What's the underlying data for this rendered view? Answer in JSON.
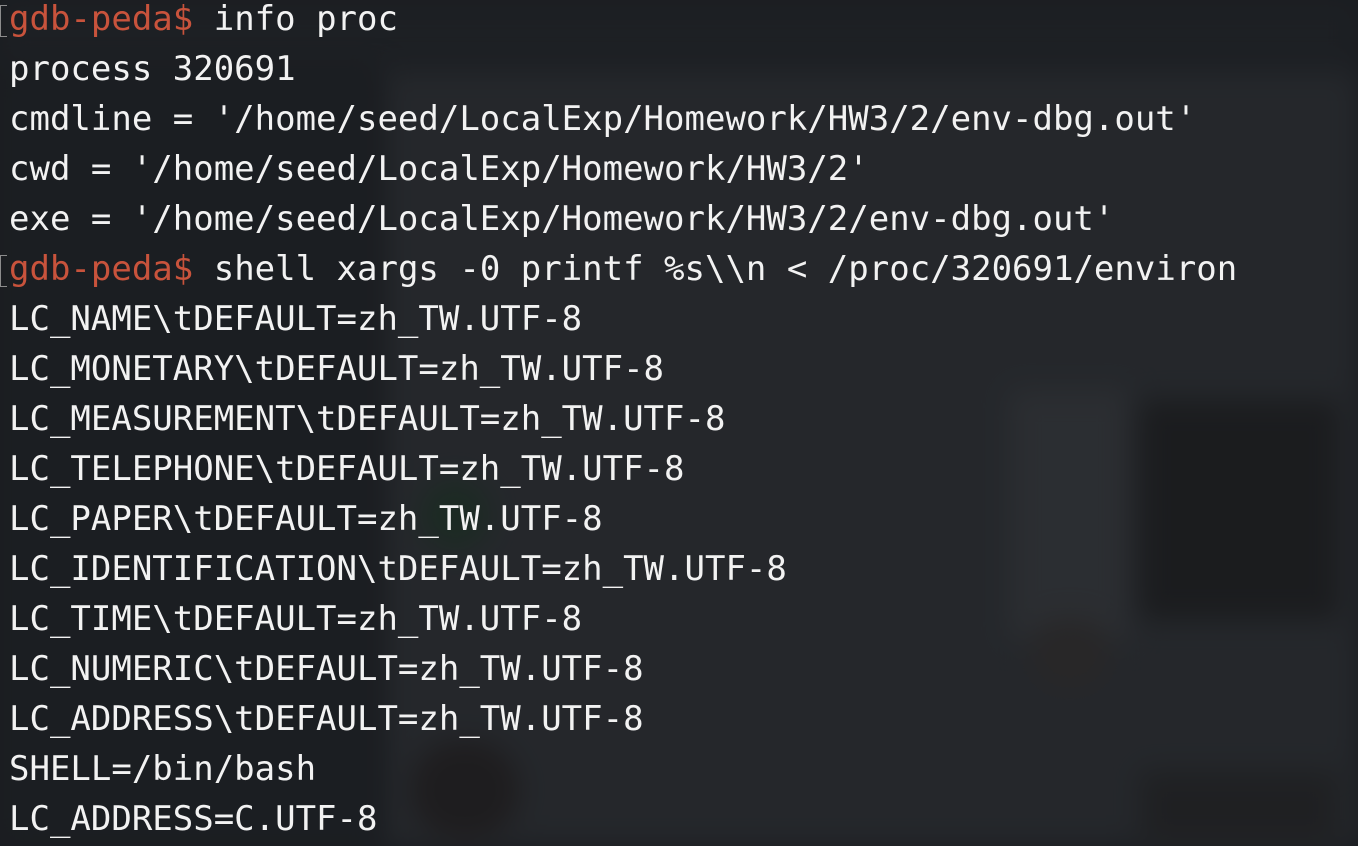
{
  "terminal": {
    "prompt": "gdb-peda$",
    "lines": [
      {
        "type": "prompt",
        "command": "info proc"
      },
      {
        "type": "output",
        "text": "process 320691"
      },
      {
        "type": "output",
        "text": "cmdline = '/home/seed/LocalExp/Homework/HW3/2/env-dbg.out'"
      },
      {
        "type": "output",
        "text": "cwd = '/home/seed/LocalExp/Homework/HW3/2'"
      },
      {
        "type": "output",
        "text": "exe = '/home/seed/LocalExp/Homework/HW3/2/env-dbg.out'"
      },
      {
        "type": "prompt",
        "command": "shell xargs -0 printf %s\\\\n < /proc/320691/environ"
      },
      {
        "type": "output",
        "text": "LC_NAME\\tDEFAULT=zh_TW.UTF-8"
      },
      {
        "type": "output",
        "text": "LC_MONETARY\\tDEFAULT=zh_TW.UTF-8"
      },
      {
        "type": "output",
        "text": "LC_MEASUREMENT\\tDEFAULT=zh_TW.UTF-8"
      },
      {
        "type": "output",
        "text": "LC_TELEPHONE\\tDEFAULT=zh_TW.UTF-8"
      },
      {
        "type": "output",
        "text": "LC_PAPER\\tDEFAULT=zh_TW.UTF-8"
      },
      {
        "type": "output",
        "text": "LC_IDENTIFICATION\\tDEFAULT=zh_TW.UTF-8"
      },
      {
        "type": "output",
        "text": "LC_TIME\\tDEFAULT=zh_TW.UTF-8"
      },
      {
        "type": "output",
        "text": "LC_NUMERIC\\tDEFAULT=zh_TW.UTF-8"
      },
      {
        "type": "output",
        "text": "LC_ADDRESS\\tDEFAULT=zh_TW.UTF-8"
      },
      {
        "type": "output",
        "text": "SHELL=/bin/bash"
      },
      {
        "type": "output",
        "text": "LC_ADDRESS=C.UTF-8"
      }
    ]
  },
  "colors": {
    "prompt": "#c8533c",
    "text": "#f2f2f2",
    "background": "#181a1e"
  }
}
